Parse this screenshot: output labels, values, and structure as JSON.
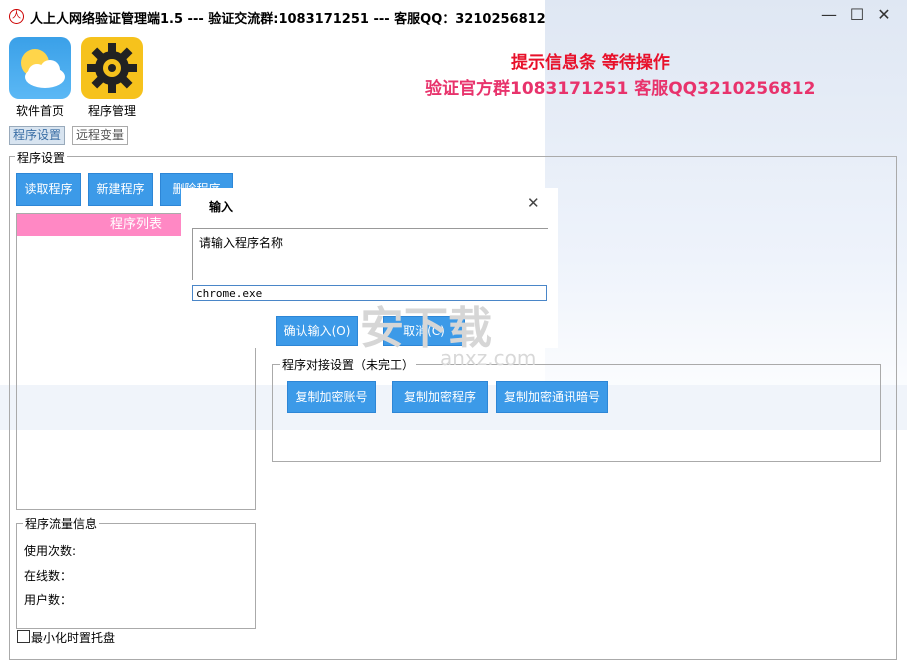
{
  "window": {
    "title": "人上人网络验证管理端1.5 --- 验证交流群:1083171251 --- 客服QQ：3210256812",
    "minimize": "—",
    "maximize": "☐",
    "close": "✕"
  },
  "tiles": [
    {
      "label": "软件首页",
      "icon": "cloud-sun-icon"
    },
    {
      "label": "程序管理",
      "icon": "gear-icon"
    }
  ],
  "hint": {
    "line1": "提示信息条 等待操作",
    "line2": "验证官方群1083171251 客服QQ3210256812",
    "color1": "#e8102a",
    "color2": "#e8336c"
  },
  "tabs": [
    "程序设置",
    "远程变量"
  ],
  "program_settings": {
    "group_label": "程序设置",
    "buttons": [
      "读取程序",
      "新建程序",
      "删除程序"
    ],
    "list_header": "程序列表"
  },
  "traffic": {
    "group_label": "程序流量信息",
    "fields": [
      "使用次数:",
      "在线数：",
      "用户数："
    ]
  },
  "minimize_tray": "最小化时置托盘",
  "docking": {
    "group_label": "程序对接设置（未完工）",
    "buttons": [
      "复制加密账号",
      "复制加密程序",
      "复制加密通讯暗号"
    ]
  },
  "dialog": {
    "title": "输入",
    "close": "✕",
    "prompt": "请输入程序名称",
    "value": "chrome.exe",
    "ok": "确认输入(O)",
    "cancel": "取消(C)"
  },
  "watermark": {
    "text": "安下载",
    "url": "anxz.com"
  },
  "colors": {
    "accent_blue": "#3c9ae8",
    "list_header_pink": "#ff88c4"
  }
}
